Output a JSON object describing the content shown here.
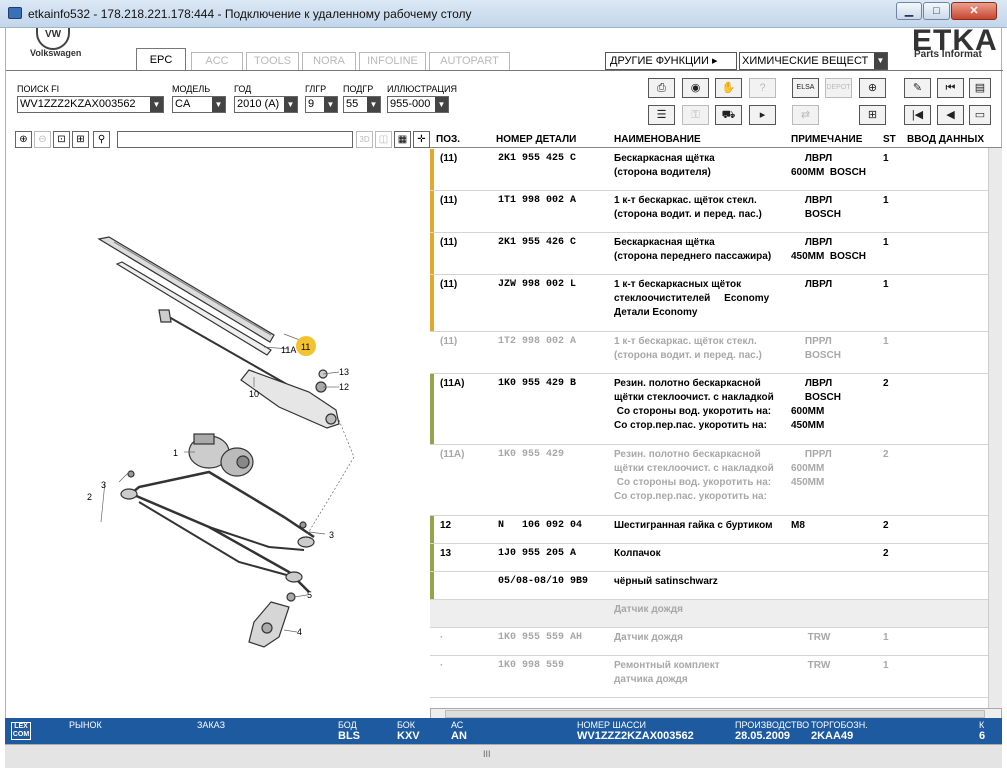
{
  "window": {
    "title": "etkainfo532 - 178.218.221.178:444 - Подключение к удаленному рабочему столу",
    "minimize": "▁",
    "maximize": "□",
    "close": "✕"
  },
  "header": {
    "vw_logo": "VW",
    "vw_name": "Volkswagen",
    "etka_logo": "ETKA",
    "etka_sub": "Parts Informat"
  },
  "tabs": [
    "EPC",
    "ACC",
    "TOOLS",
    "NORA",
    "INFOLINE",
    "AUTOPART"
  ],
  "other_functions": "ДРУГИЕ ФУНКЦИИ ▸",
  "chem_select": "ХИМИЧЕСКИЕ ВЕЩЕСТ",
  "filters": {
    "search_label": "ПОИСК FI",
    "search_value": "WV1ZZZ2KZAX003562",
    "model_label": "МОДЕЛЬ",
    "model_value": "CA",
    "year_label": "ГОД",
    "year_value": "2010 (A)",
    "glgr_label": "ГЛГР",
    "glgr_value": "9",
    "podgr_label": "ПОДГР",
    "podgr_value": "55",
    "illus_label": "ИЛЛЮСТРАЦИЯ",
    "illus_value": "955-000"
  },
  "toolbar_icons": {
    "row1": [
      "printer-icon",
      "cd-icon",
      "handshake-icon",
      "help-icon",
      "elsa-icon",
      "depot-icon",
      "cart-add-icon",
      "pin-icon",
      "first-icon",
      "doc-icon"
    ],
    "row2": [
      "list-icon",
      "key-icon",
      "car-icon",
      "play-icon",
      "transfer-icon",
      "cart-icon",
      "skip-first-icon",
      "prev-icon",
      "page-icon"
    ],
    "elsa_label": "ELSA",
    "depot_label": "DEPOT",
    "lleft_3d": "3D"
  },
  "table": {
    "headers": {
      "pos": "ПОЗ.",
      "part": "НОМЕР ДЕТАЛИ",
      "name": "НАИМЕНОВАНИЕ",
      "note": "ПРИМЕЧАНИЕ",
      "st": "ST",
      "input": "ВВОД ДАННЫХ"
    },
    "rows": [
      {
        "pos": "(11)",
        "part": "2K1 955 425 C",
        "name": "Бескаркасная щётка\n(сторона водителя)",
        "note": "     ЛВРЛ\n600ММ  BOSCH",
        "st": "1",
        "bar": "#e2a82c",
        "dim": false,
        "h": 42
      },
      {
        "pos": "(11)",
        "part": "1T1 998 002 A",
        "name": "1 к-т бескаркас. щёток стекл.\n(сторона водит. и перед. пас.)",
        "note": "     ЛВРЛ\n     BOSCH",
        "st": "1",
        "bar": "#e2a82c",
        "dim": false,
        "h": 42
      },
      {
        "pos": "(11)",
        "part": "2K1 955 426 C",
        "name": "Бескаркасная щётка\n(сторона переднего пассажира)",
        "note": "     ЛВРЛ\n450ММ  BOSCH",
        "st": "1",
        "bar": "#e2a82c",
        "dim": false,
        "h": 42
      },
      {
        "pos": "(11)",
        "part": "JZW 998 002 L",
        "name": "1 к-т бескаркасных щёток\nстеклоочистителей     Economy\nДетали Economy",
        "note": "     ЛВРЛ",
        "st": "1",
        "bar": "#e2a82c",
        "dim": false,
        "h": 57
      },
      {
        "pos": "(11)",
        "part": "1T2 998 002 A",
        "name": "1 к-т бескаркас. щёток стекл.\n(сторона водит. и перед. пас.)",
        "note": "     ПРРЛ\n     BOSCH",
        "st": "1",
        "bar": "",
        "dim": true,
        "h": 42
      },
      {
        "pos": "(11A)",
        "part": "1K0 955 429 B",
        "name": "Резин. полотно бескаркасной\nщётки стеклоочист. с накладкой\n Со стороны вод. укоротить на:\nСо стор.пер.пас. укоротить на:",
        "note": "     ЛВРЛ\n     BOSCH\n600ММ\n450ММ",
        "st": "2",
        "bar": "#93a548",
        "dim": false,
        "h": 71
      },
      {
        "pos": "(11A)",
        "part": "1K0 955 429",
        "name": "Резин. полотно бескаркасной\nщётки стеклоочист. с накладкой\n Со стороны вод. укоротить на:\nСо стор.пер.пас. укоротить на:",
        "note": "     ПРРЛ\n600ММ\n450ММ",
        "st": "2",
        "bar": "",
        "dim": true,
        "h": 71
      },
      {
        "pos": "12",
        "part": "N   106 092 04",
        "name": "Шестигранная гайка с буртиком",
        "note": "M8",
        "st": "2",
        "bar": "#93a548",
        "dim": false,
        "h": 28
      },
      {
        "pos": "13",
        "part": "1J0 955 205 A",
        "name": "Колпачок",
        "note": "",
        "st": "2",
        "bar": "#93a548",
        "dim": false,
        "h": 28
      },
      {
        "pos": "",
        "part": "05/08-08/10 9B9",
        "name": "чёрный satinschwarz",
        "note": "",
        "st": "",
        "bar": "#93a548",
        "dim": false,
        "h": 28
      },
      {
        "pos": "",
        "part": "",
        "name": "Датчик дождя",
        "note": "",
        "st": "",
        "bar": "",
        "dim": true,
        "grey": true,
        "h": 28
      },
      {
        "pos": "·",
        "part": "1K0 955 559 AH",
        "name": "Датчик дождя",
        "note": "      TRW",
        "st": "1",
        "bar": "",
        "dim": true,
        "h": 28
      },
      {
        "pos": "·",
        "part": "1K0 998 559",
        "name": "Ремонтный комплект\nдатчика дождя",
        "note": "      TRW",
        "st": "1",
        "bar": "",
        "dim": true,
        "h": 42
      }
    ]
  },
  "diagram_labels": [
    "11",
    "11A",
    "13",
    "12",
    "10",
    "1",
    "3",
    "2",
    "3",
    "5",
    "4"
  ],
  "status": {
    "logo": "LEX\nCOM",
    "market_label": "РЫНОК",
    "order_label": "ЗАКАЗ",
    "bod_label": "БОД",
    "bod_value": "BLS",
    "bok_label": "БОК",
    "bok_value": "KXV",
    "as_label": "АС",
    "as_value": "AN",
    "chassis_label": "НОМЕР ШАССИ",
    "chassis_value": "WV1ZZZ2KZAX003562",
    "prod_label": "ПРОИЗВОДСТВО",
    "prod_value": "28.05.2009",
    "trade_label": "ТОРГОБОЗН.",
    "trade_value": "2KAA49",
    "k_label": "К",
    "k_value": "6"
  },
  "grip": "III"
}
